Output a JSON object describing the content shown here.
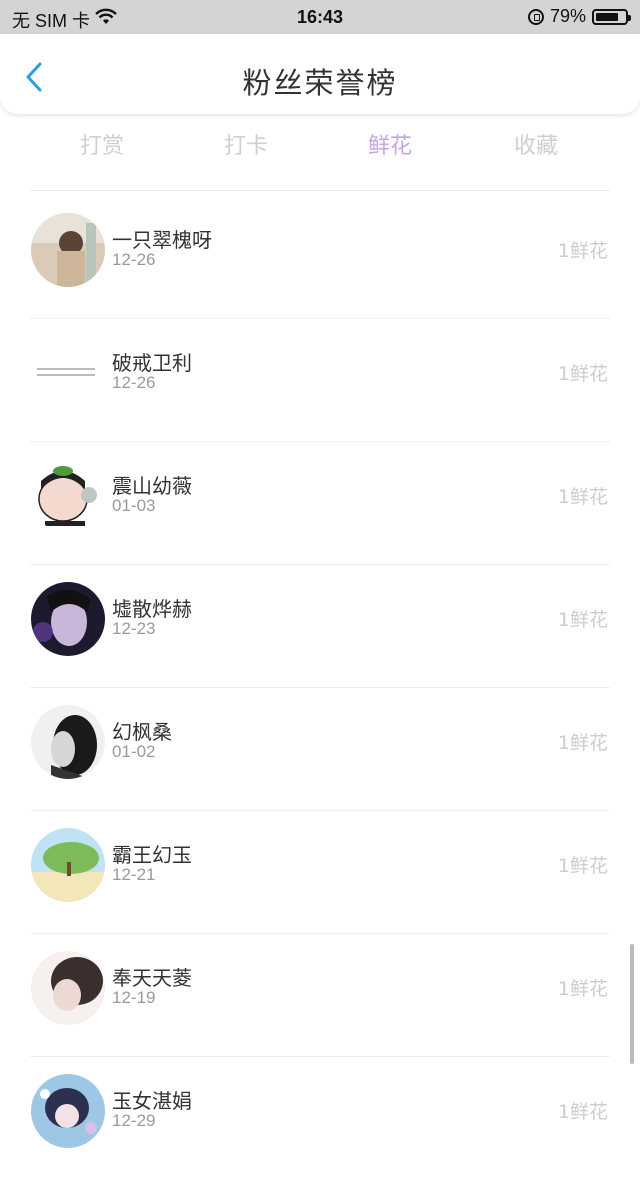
{
  "status_bar": {
    "carrier": "无 SIM 卡",
    "time": "16:43",
    "battery": "79%",
    "battery_level": 0.79
  },
  "header": {
    "title": "粉丝荣誉榜",
    "back_icon": "chevron-left-icon",
    "accent_color": "#2d9de0"
  },
  "tabs": [
    {
      "label": "打赏",
      "active": false
    },
    {
      "label": "打卡",
      "active": false
    },
    {
      "label": "鲜花",
      "active": true
    },
    {
      "label": "收藏",
      "active": false
    }
  ],
  "list": [
    {
      "name": "一只翠槐呀",
      "date": "12-26",
      "amount": "1鲜花"
    },
    {
      "name": "破戒卫利",
      "date": "12-26",
      "amount": "1鲜花"
    },
    {
      "name": "震山幼薇",
      "date": "01-03",
      "amount": "1鲜花"
    },
    {
      "name": "墟散烨赫",
      "date": "12-23",
      "amount": "1鲜花"
    },
    {
      "name": "幻枫桑",
      "date": "01-02",
      "amount": "1鲜花"
    },
    {
      "name": "霸王幻玉",
      "date": "12-21",
      "amount": "1鲜花"
    },
    {
      "name": "奉天天菱",
      "date": "12-19",
      "amount": "1鲜花"
    },
    {
      "name": "玉女湛娟",
      "date": "12-29",
      "amount": "1鲜花"
    }
  ]
}
